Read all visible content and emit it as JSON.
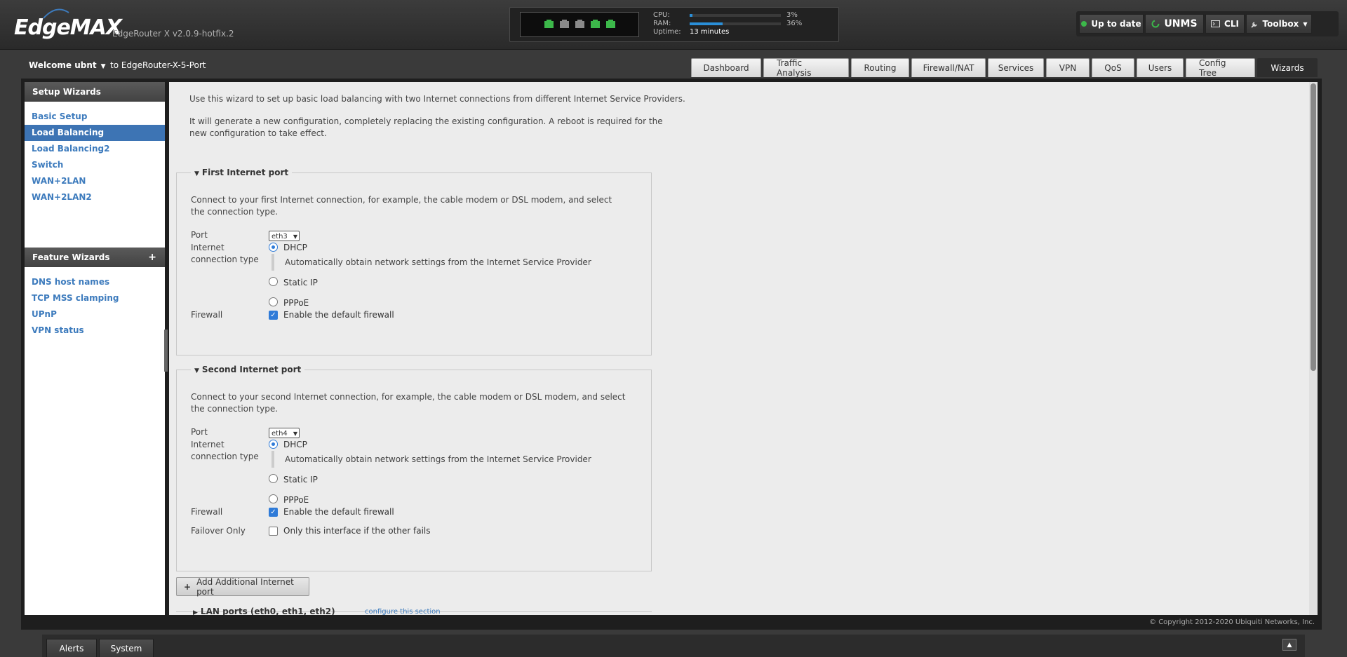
{
  "header": {
    "logo": "EdgeMAX",
    "version": "EdgeRouter X v2.0.9-hotfix.2",
    "ports": [
      "up",
      "down",
      "down",
      "up",
      "up"
    ],
    "cpu_label": "CPU:",
    "cpu_value": "3%",
    "cpu_fraction": 0.03,
    "ram_label": "RAM:",
    "ram_value": "36%",
    "ram_fraction": 0.36,
    "uptime_label": "Uptime:",
    "uptime_value": "13 minutes",
    "buttons": {
      "up_to_date": "Up to date",
      "unms": "UNMS",
      "cli": "CLI",
      "toolbox": "Toolbox"
    }
  },
  "topbar": {
    "welcome": "Welcome ubnt",
    "router": "to EdgeRouter-X-5-Port",
    "tabs": [
      "Dashboard",
      "Traffic Analysis",
      "Routing",
      "Firewall/NAT",
      "Services",
      "VPN",
      "QoS",
      "Users",
      "Config Tree",
      "Wizards"
    ],
    "active_tab": "Wizards"
  },
  "sidebar": {
    "setup_title": "Setup Wizards",
    "setup_items": [
      "Basic Setup",
      "Load Balancing",
      "Load Balancing2",
      "Switch",
      "WAN+2LAN",
      "WAN+2LAN2"
    ],
    "active_item": "Load Balancing",
    "feature_title": "Feature Wizards",
    "feature_plus": "+",
    "feature_items": [
      "DNS host names",
      "TCP MSS clamping",
      "UPnP",
      "VPN status"
    ]
  },
  "content": {
    "intro1": "Use this wizard to set up basic load balancing with two Internet connections from different Internet Service Providers.",
    "intro2": "It will generate a new configuration, completely replacing the existing configuration. A reboot is required for the new configuration to take effect.",
    "first": {
      "legend": "First Internet port",
      "desc": "Connect to your first Internet connection, for example, the cable modem or DSL modem, and select the connection type.",
      "port_label": "Port",
      "port_value": "eth3",
      "conn_label": "Internet connection type",
      "dhcp": "DHCP",
      "dhcp_desc": "Automatically obtain network settings from the Internet Service Provider",
      "static": "Static IP",
      "pppoe": "PPPoE",
      "firewall_label": "Firewall",
      "firewall_text": "Enable the default firewall"
    },
    "second": {
      "legend": "Second Internet port",
      "desc": "Connect to your second Internet connection, for example, the cable modem or DSL modem, and select the connection type.",
      "port_label": "Port",
      "port_value": "eth4",
      "conn_label": "Internet connection type",
      "dhcp": "DHCP",
      "dhcp_desc": "Automatically obtain network settings from the Internet Service Provider",
      "static": "Static IP",
      "pppoe": "PPPoE",
      "firewall_label": "Firewall",
      "firewall_text": "Enable the default firewall",
      "failover_label": "Failover Only",
      "failover_text": "Only this interface if the other fails"
    },
    "add_port": "Add Additional Internet port",
    "lan_legend": "LAN ports (eth0, eth1, eth2)",
    "lan_link": "configure this section"
  },
  "copyright": "© Copyright 2012-2020 Ubiquiti Networks, Inc.",
  "footer": {
    "alerts": "Alerts",
    "system": "System"
  }
}
